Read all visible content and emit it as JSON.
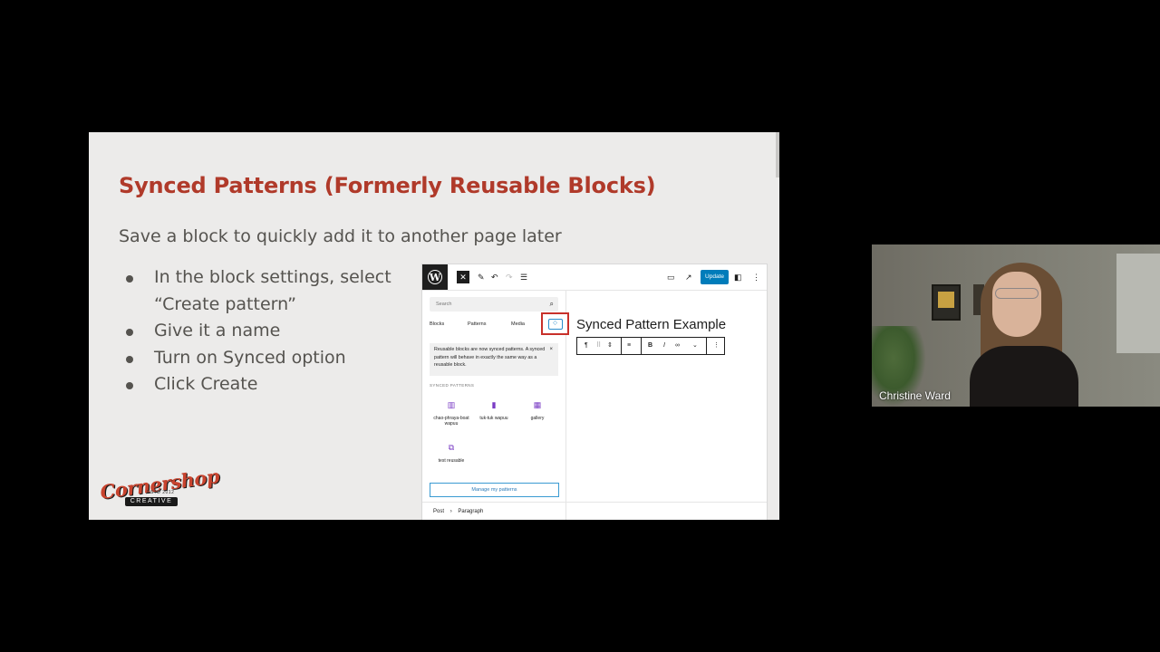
{
  "slide": {
    "title": "Synced Patterns (Formerly Reusable Blocks)",
    "subtitle": "Save a block to quickly add it to another page later",
    "bullets": [
      "In the block settings, select “Create pattern”",
      "Give it a name",
      "Turn on Synced option",
      "Click Create"
    ],
    "logo": {
      "script": "Cornershop",
      "est": "ESTD 2012",
      "sub": "CREATIVE"
    }
  },
  "editor": {
    "update_label": "Update",
    "search_placeholder": "Search",
    "tabs": [
      "Blocks",
      "Patterns",
      "Media"
    ],
    "notice": "Reusable blocks are now synced patterns. A synced pattern will behave in exactly the same way as a reusable block.",
    "notice_close": "×",
    "section_label": "SYNCED PATTERNS",
    "patterns": [
      "chao-phraya-boat wapuu",
      "tuk-tuk wapuu",
      "gallery",
      "test reusable"
    ],
    "manage_label": "Manage my patterns",
    "canvas_title": "Synced Pattern Example",
    "breadcrumb": [
      "Post",
      "Paragraph"
    ]
  },
  "participant": {
    "name": "Christine Ward"
  },
  "colors": {
    "title_red": "#b03a2a",
    "update_blue": "#007cba",
    "highlight_red": "#c8302a"
  }
}
